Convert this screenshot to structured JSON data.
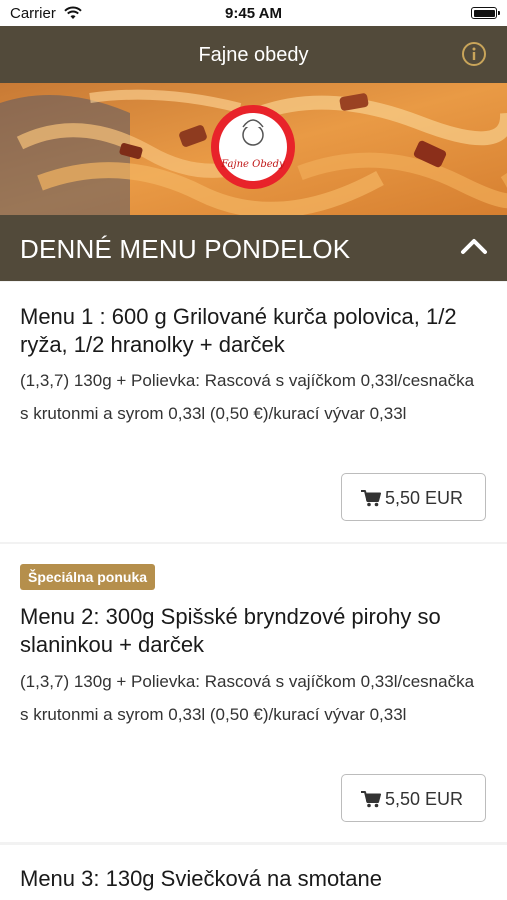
{
  "status_bar": {
    "carrier": "Carrier",
    "time": "9:45 AM"
  },
  "navbar": {
    "title": "Fajne obedy"
  },
  "hero": {
    "logo_text": "Fajne Obedy"
  },
  "section": {
    "title": "DENNÉ MENU PONDELOK"
  },
  "menus": [
    {
      "title": "Menu 1 : 600 g Grilované kurča polovica, 1/2 ryža, 1/2 hranolky + darček",
      "description": "(1,3,7) 130g + Polievka: Rascová s vajíčkom 0,33l/cesnačka s krutonmi a syrom 0,33l (0,50 €)/kurací vývar 0,33l",
      "price": "5,50 EUR"
    },
    {
      "badge": "Špeciálna ponuka",
      "title": "Menu 2: 300g Spišské bryndzové pirohy so slaninkou + darček",
      "description": "(1,3,7) 130g + Polievka: Rascová s vajíčkom 0,33l/cesnačka s krutonmi a syrom 0,33l (0,50 €)/kurací vývar 0,33l",
      "price": "5,50 EUR"
    },
    {
      "title": "Menu 3: 130g Sviečková na smotane"
    }
  ],
  "colors": {
    "brand_brown": "#524a3a",
    "badge_gold": "#b58f4c",
    "info_gold": "#c9a55a"
  },
  "icons": {
    "wifi": "wifi-icon",
    "battery": "battery-icon",
    "info": "info-icon",
    "chevron": "chevron-up-icon",
    "cart": "cart-icon"
  }
}
